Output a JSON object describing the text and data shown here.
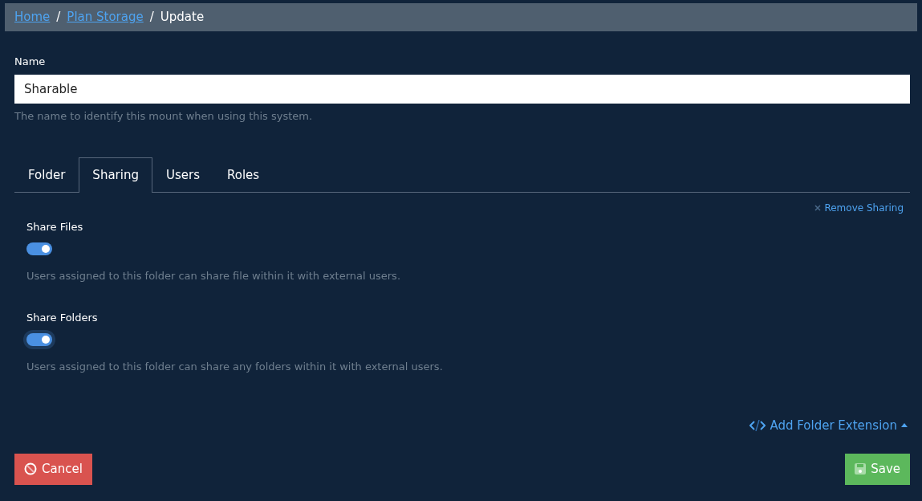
{
  "breadcrumb_separator": "/",
  "breadcrumb": [
    {
      "label": "Home",
      "kind": "link"
    },
    {
      "label": "Plan Storage",
      "kind": "link"
    },
    {
      "label": "Update",
      "kind": "current"
    }
  ],
  "name_field": {
    "label": "Name",
    "value": "Sharable",
    "help": "The name to identify this mount when using this system."
  },
  "tabs": [
    {
      "label": "Folder",
      "selected": false
    },
    {
      "label": "Sharing",
      "selected": true
    },
    {
      "label": "Users",
      "selected": false
    },
    {
      "label": "Roles",
      "selected": false
    }
  ],
  "remove_link": "Remove Sharing",
  "settings": [
    {
      "label": "Share Files",
      "checked": true,
      "focused": false,
      "help": "Users assigned to this folder can share file within it with external users."
    },
    {
      "label": "Share Folders",
      "checked": true,
      "focused": true,
      "help": "Users assigned to this folder can share any folders within it with external users."
    }
  ],
  "extension_link": {
    "label": "Add Folder Extension",
    "expanded": true
  },
  "buttons": [
    {
      "label": "Cancel",
      "kind": "cancel"
    },
    {
      "label": "Save",
      "kind": "save"
    }
  ]
}
